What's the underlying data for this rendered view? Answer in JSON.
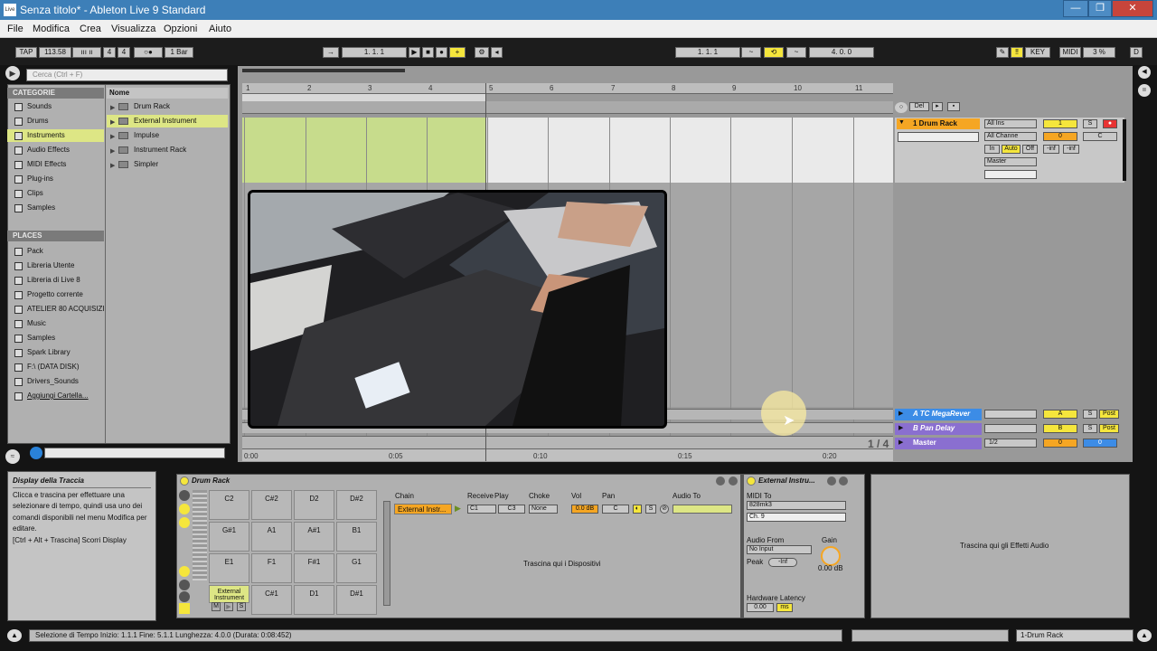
{
  "window": {
    "title": "Senza titolo* - Ableton Live 9 Standard",
    "app_icon_label": "Live",
    "minimize": "—",
    "maximize": "❐",
    "close": "✕"
  },
  "menu": [
    "File",
    "Modifica",
    "Crea",
    "Visualizza",
    "Opzioni",
    "Aiuto"
  ],
  "control_bar": {
    "tap": "TAP",
    "tempo": "113.58",
    "signature_num": "4",
    "signature_den": "4",
    "metronome": "○●",
    "quantize": "1 Bar",
    "position": "1.   1.   1",
    "loop_start": "1.   1.   1",
    "loop_length": "4.   0.   0",
    "key": "KEY",
    "midi": "MIDI",
    "cpu": "3 %",
    "disk": "D"
  },
  "browser": {
    "search_placeholder": "Cerca (Ctrl + F)",
    "categories_header": "CATEGORIE",
    "categories": [
      "Sounds",
      "Drums",
      "Instruments",
      "Audio Effects",
      "MIDI Effects",
      "Plug-ins",
      "Clips",
      "Samples"
    ],
    "selected_category": "Instruments",
    "places_header": "PLACES",
    "places": [
      "Pack",
      "Libreria Utente",
      "Libreria di Live 8",
      "Progetto corrente",
      "ATELIER 80 ACQUISIZIO",
      "Music",
      "Samples",
      "Spark Library",
      "F:\\ (DATA DISK)",
      "Drivers_Sounds",
      "Aggiungi Cartella..."
    ],
    "name_header": "Nome",
    "items": [
      "Drum Rack",
      "External Instrument",
      "Impulse",
      "Instrument Rack",
      "Simpler"
    ],
    "selected_item": "External Instrument"
  },
  "arrangement": {
    "bars": [
      "1",
      "2",
      "3",
      "4",
      "5",
      "6",
      "7",
      "8",
      "9",
      "10",
      "11"
    ],
    "times": [
      "0:00",
      "0:05",
      "0:10",
      "0:15",
      "0:20"
    ],
    "page": "1 / 4",
    "del_label": "Del",
    "tracks": [
      {
        "name": "1 Drum Rack",
        "input": "All Ins",
        "channel": "All Channe",
        "monitor": [
          "In",
          "Auto",
          "Off"
        ],
        "output": "Master",
        "number": "1",
        "solo": "S",
        "vol": "0",
        "pan": "C",
        "peak_l": "-inf",
        "peak_r": "-inf"
      },
      {
        "name": "A TC MegaRever",
        "send": "A",
        "solo": "S",
        "post": "Post"
      },
      {
        "name": "B Pan Delay",
        "send": "B",
        "solo": "S",
        "post": "Post"
      },
      {
        "name": "Master",
        "output": "1/2",
        "vol": "0",
        "pan": "0"
      }
    ]
  },
  "info_view": {
    "title": "Display della Traccia",
    "body": "Clicca e trascina per effettuare una selezionare di tempo, quindi usa uno dei comandi disponibili nel menu Modifica per editare.",
    "shortcut": "[Ctrl + Alt + Trascina] Scorri Display"
  },
  "drum_rack": {
    "title": "Drum Rack",
    "pads": [
      [
        "C2",
        "C#2",
        "D2",
        "D#2"
      ],
      [
        "G#1",
        "A1",
        "A#1",
        "B1"
      ],
      [
        "E1",
        "F1",
        "F#1",
        "G1"
      ],
      [
        "External Instrument",
        "C#1",
        "D1",
        "D#1"
      ]
    ],
    "pad_buttons": [
      "M",
      "▶",
      "S"
    ],
    "chain_headers": [
      "Chain",
      "Receive",
      "Play",
      "Choke",
      "Vol",
      "Pan",
      "Audio To"
    ],
    "chain": {
      "name": "External Instr...",
      "receive": "C1",
      "play": "C3",
      "choke": "None",
      "vol": "0.0 dB",
      "pan": "C"
    },
    "drop_devices": "Trascina qui i Dispositivi"
  },
  "external_instrument": {
    "title": "External Instru...",
    "midi_to_label": "MIDI To",
    "midi_to": "828mk3",
    "channel": "Ch. 9",
    "audio_from_label": "Audio From",
    "audio_from": "No Input",
    "gain_label": "Gain",
    "gain": "0.00 dB",
    "peak_label": "Peak",
    "peak": "-Inf",
    "latency_label": "Hardware Latency",
    "latency": "0.00",
    "latency_unit": "ms"
  },
  "effects_drop": "Trascina qui gli Effetti Audio",
  "status": {
    "text": "Selezione di Tempo    Inizio: 1.1.1    Fine: 5.1.1    Lunghezza: 4.0.0   (Durata: 0:08:452)",
    "track": "1-Drum Rack"
  },
  "colors": {
    "accent_yellow": "#f5e63c",
    "clip_green": "#c7dc8c",
    "orange": "#f5a623",
    "return_blue": "#3c8ce6",
    "return_purple": "#8a6fd0",
    "record_red": "#e83232"
  }
}
